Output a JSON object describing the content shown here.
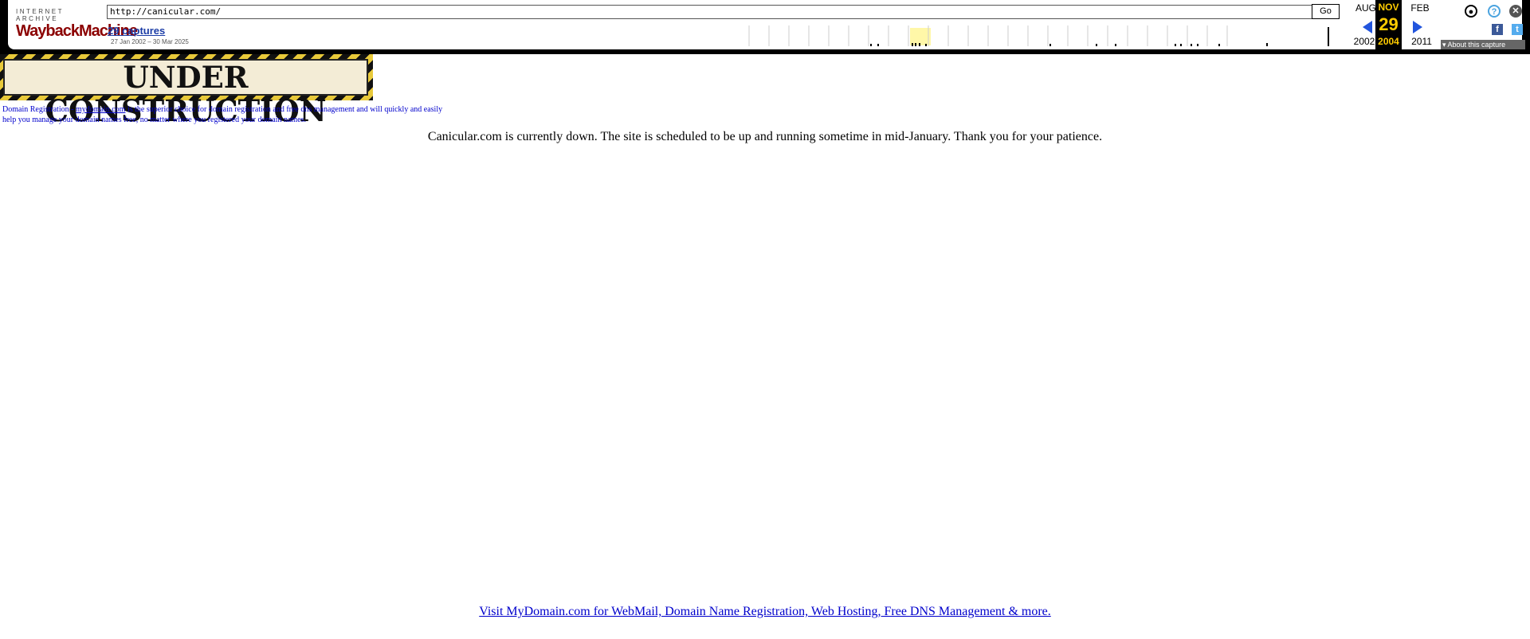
{
  "toolbar": {
    "logo_top": "INTERNET ARCHIVE",
    "logo_main": "WaybackMachine",
    "url_value": "http://canicular.com/",
    "go_label": "Go",
    "captures_label": "29 captures",
    "captures_range": "27 Jan 2002 – 30 Mar 2025",
    "prev_month": "AUG",
    "prev_year": "2002",
    "current_month": "NOV",
    "current_day": "29",
    "current_year": "2004",
    "next_month": "FEB",
    "next_year": "2011",
    "about_label": "About this capture",
    "icons": {
      "user": "user-icon",
      "help": "help-icon",
      "close": "close-icon",
      "facebook": "facebook-icon",
      "twitter": "twitter-icon",
      "prev": "arrow-left-icon",
      "next": "arrow-right-icon"
    },
    "colors": {
      "highlight": "#ffcc00",
      "arrow": "#2255dd"
    }
  },
  "page": {
    "banner_text": "UNDER CONSTRUCTION",
    "registration_prefix": "Domain Registration -",
    "registration_link": "mydomain.com",
    "registration_suffix": "is the superior choice for domain registration and free dns management and will quickly and easily help you manage your domain names free, no matter where you registered your domain names.",
    "down_message": "Canicular.com is currently down. The site is scheduled to be up and running sometime in mid-January. Thank you for your patience.",
    "footer_link": "Visit MyDomain.com for WebMail, Domain Name Registration, Web Hosting, Free DNS Management & more."
  }
}
